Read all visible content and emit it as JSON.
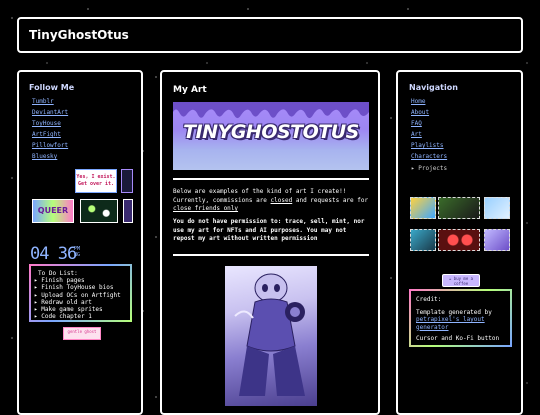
{
  "header": {
    "title": "TinyGhostOtus"
  },
  "left": {
    "heading": "Follow Me",
    "links": [
      "Tumblr",
      "DeviantArt",
      "ToyHouse",
      "ArtFight",
      "Pillowfort",
      "Bluesky"
    ],
    "badge_text": "Yes, I exist. Get over it.",
    "queer_button": "QUEER",
    "clock_time": "04 36",
    "clock_ampm": "PM",
    "clock_day": "NG",
    "todo": {
      "title": "To Do List:",
      "items": [
        "Finish pages",
        "Finish ToyHouse bios",
        "Upload OCs on Artfight",
        "Redraw old art",
        "Make game sprites",
        "Code chapter 1"
      ]
    },
    "stamp_text": "gentle ghost"
  },
  "main": {
    "heading": "My Art",
    "banner_text": "TINYGHOSTOTUS",
    "intro_line": "Below are examples of the kind of art I create!! Currently, commissions are",
    "closed_text": "closed",
    "requests_text": "and requests are for",
    "friends_text": "close friends only",
    "warning": "You do not have permission to: trace, sell, mint, nor use my art for NFTs and AI purposes. You may not repost my art without written permission"
  },
  "right": {
    "heading": "Navigation",
    "nav": [
      "Home",
      "About",
      "FAQ",
      "Art",
      "Playlists",
      "Characters"
    ],
    "projects_label": "Projects",
    "kofi_text": "buy me a coffee",
    "credit": {
      "title": "Credit:",
      "line1": "Template generated by",
      "link": "petrapixel's layout generator",
      "line2": "Cursor and Ko-Fi button"
    }
  },
  "colors": {
    "link": "#8fb4ff",
    "accent": "#a78bfa",
    "background": "#000000"
  }
}
